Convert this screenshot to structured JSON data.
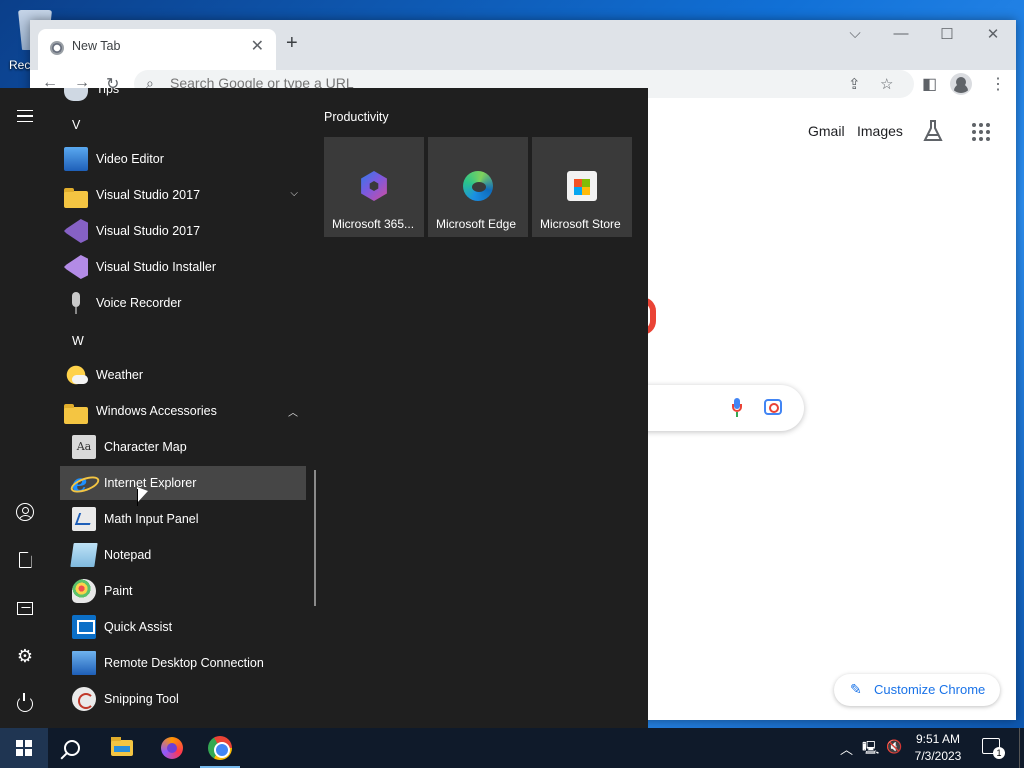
{
  "desktop": {
    "recycle_bin_label": "Rec"
  },
  "chrome": {
    "tab_title": "New Tab",
    "omnibox_placeholder": "Search Google or type a URL",
    "page": {
      "gmail": "Gmail",
      "images": "Images",
      "customize": "Customize Chrome"
    }
  },
  "start": {
    "partial_top_item": "Tips",
    "letters": {
      "v": "V",
      "w": "W"
    },
    "apps": {
      "video_editor": "Video Editor",
      "vs2017_folder": "Visual Studio 2017",
      "vs2017": "Visual Studio 2017",
      "vs_installer": "Visual Studio Installer",
      "voice_recorder": "Voice Recorder",
      "weather": "Weather",
      "win_accessories": "Windows Accessories",
      "character_map": "Character Map",
      "internet_explorer": "Internet Explorer",
      "math_input": "Math Input Panel",
      "notepad": "Notepad",
      "paint": "Paint",
      "quick_assist": "Quick Assist",
      "rdc": "Remote Desktop Connection",
      "snipping_tool": "Snipping Tool"
    },
    "tiles_group": "Productivity",
    "tiles": {
      "m365": "Microsoft 365...",
      "edge": "Microsoft Edge",
      "store": "Microsoft Store"
    }
  },
  "taskbar": {
    "time": "9:51 AM",
    "date": "7/3/2023",
    "notification_count": "1"
  }
}
